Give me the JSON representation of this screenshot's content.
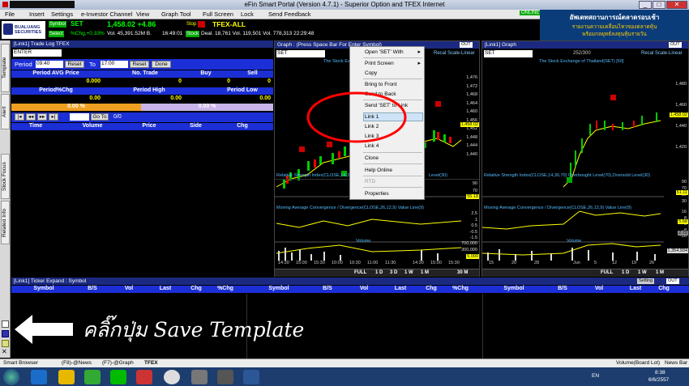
{
  "window": {
    "title": "eFin Smart Portal (Version 4.7.1) - Superior Option and TFEX Internet",
    "min": "_",
    "max": "□",
    "close": "✕"
  },
  "menu": [
    "File",
    "Insert",
    "Settings",
    "e-Investor Channel",
    "View",
    "Graph Tool",
    "Full Screen",
    "Lock",
    "Send Feedback"
  ],
  "online_label": "ONLINE",
  "info": {
    "broker": "BUALUANG SECURITIES",
    "symbol_tag": "Symbol",
    "symbol": "SET",
    "price": "1,458.02 +4.86",
    "select_tag": "Select",
    "pct_chg": "%Chg,+0.33%",
    "vol_val": "Vol. 45,391.52M B.",
    "time1": "16:49:01",
    "stop_tag": "Stop",
    "stock_tag": "Stock",
    "tfex": "TFEX-ALL",
    "deal": "Deal. 18,761 Vol. 119,501 Vol. 778,313 22:29:48"
  },
  "ad": {
    "line1": "อัพเดทสถานการณ์ตลาดรอบเช้า",
    "line2": "รายงานความเคลื่อนไหวของตลาดหุ้น",
    "line3": "พร้อมกลยุทธ์ลงทุนหุ้นรายวัน"
  },
  "left_tabs": [
    "Template",
    "Alert",
    "Stock Focus",
    "Related Info"
  ],
  "tradelog": {
    "header": "[Link1] Trade Log TFEX",
    "enter": "ENTER",
    "period_label": "Period",
    "from": "09:40",
    "reset": "Reset",
    "to_label": "To",
    "to": "17:00",
    "reset2": "Reset",
    "done": "Done",
    "r1": [
      "Period AVG Price",
      "No. Trade",
      "Buy",
      "Sell"
    ],
    "r1v": [
      "0.000",
      "0",
      "0",
      "0"
    ],
    "r2": [
      "Period%Chg",
      "Period High",
      "Period Low"
    ],
    "r2v": [
      "0.00",
      "0.00",
      "0.00"
    ],
    "bar_left": "0.00 %",
    "bar_right": "0.00 %",
    "goto": "Go To",
    "pages": "0/0",
    "cols": [
      "Time",
      "Volume",
      "Price",
      "Side",
      "Chg"
    ]
  },
  "graph1": {
    "header": "Graph : (Press Space Bar For Enter Symbol)",
    "out": "OUT",
    "symbol": "SET",
    "recal": "Recal Scale-Linear",
    "title": "The Stock Ex",
    "rsi_title": "Relative Strength Index(CLOSE,14,3",
    "rsi_tail": "Level(30)",
    "macd_title": "Moving Average Convergence / Divergence(CLOSE,26,12,9) Value Line(9)",
    "vol_title": "Volume",
    "price_axis": [
      "1,476",
      "1,472",
      "1,468",
      "1,464",
      "1,460",
      "1,456",
      "1,452",
      "1,448",
      "1,444",
      "1,440"
    ],
    "price_tag": "1,458.02",
    "rsi_axis": [
      "90",
      "70",
      "50"
    ],
    "rsi_tag": "55.18",
    "macd_axis": [
      "2.5",
      "1",
      "0.5",
      "-0.5",
      "-1.5"
    ],
    "vol_axis": [
      "700,000",
      "300,000"
    ],
    "vol_tag": "5,000",
    "x_axis": [
      "14:30",
      "15:00",
      "15:30",
      "10:00",
      "10:30",
      "11:00",
      "11:30",
      "14:30",
      "15:00",
      "15:30"
    ],
    "bottom": [
      "FULL",
      "1 D",
      "3 D",
      "1 W",
      "1 M",
      "30 M"
    ]
  },
  "graph2": {
    "header": "[Link1] Graph",
    "out": "OUT",
    "symbol": "SET",
    "count": "252/300",
    "recal": "Recal Scale-Linear",
    "title": "The Stock Exchange of Thailand(SET) [50]",
    "rsi_title": "Relative Strength Index(CLOSE,14,30,70) Overbought Level(70),Oversold Level(30)",
    "macd_title": "Moving Average Convergence / Divergence(CLOSE,26,12,9) Value Line(9)",
    "vol_title": "Volume",
    "price_axis": [
      "1,480",
      "1,460",
      "1,440",
      "1,420"
    ],
    "price_tag": "1,458.02",
    "rsi_axis": [
      "90",
      "70",
      "50",
      "30"
    ],
    "rsi_tag": "51.11",
    "macd_axis": [
      "16",
      "8",
      "0",
      "-8",
      "-16"
    ],
    "macd_tags": [
      "5.68",
      "2.72"
    ],
    "vol_tag": "1,354,934",
    "x_axis": [
      "15",
      "20",
      "28",
      "Jun",
      "5",
      "12",
      "19",
      "26"
    ],
    "bottom": [
      "FULL",
      "1 D",
      "1 W",
      "1 M"
    ]
  },
  "context_menu": {
    "items": [
      "Open 'SET' With",
      "Print Screen",
      "Copy",
      "Bring to Front",
      "Send to Back",
      "Send 'SET' to Link",
      "Link 1",
      "Link 2",
      "Link 3",
      "Link 4",
      "Clone",
      "Help Online",
      "RTD",
      "Properties"
    ],
    "open_arrow": "▸",
    "print_arrow": "▸"
  },
  "ticker": {
    "header": "[Link1] Ticker Expand : Symbol",
    "setting": "Setting",
    "out": "OUT",
    "cols": [
      "Symbol",
      "B/S",
      "Vol",
      "Last",
      "Chg",
      "%Chg"
    ]
  },
  "annotation": "คลิ๊กปุ่ม Save Template",
  "bottom_tabs": [
    "Smart Browser",
    "(F8)-@News",
    "(F7)-@Graph",
    "TFEX"
  ],
  "status_right": [
    "Volume(Board Lot)",
    "News Bar"
  ],
  "tray": {
    "lang": "EN",
    "time": "8:38",
    "date": "6/6/2557"
  },
  "colors": {
    "accent_red": "#ff0000",
    "bar_blue": "#1c2fd6",
    "header_navy": "#1b2a80",
    "up_green": "#00c000"
  }
}
